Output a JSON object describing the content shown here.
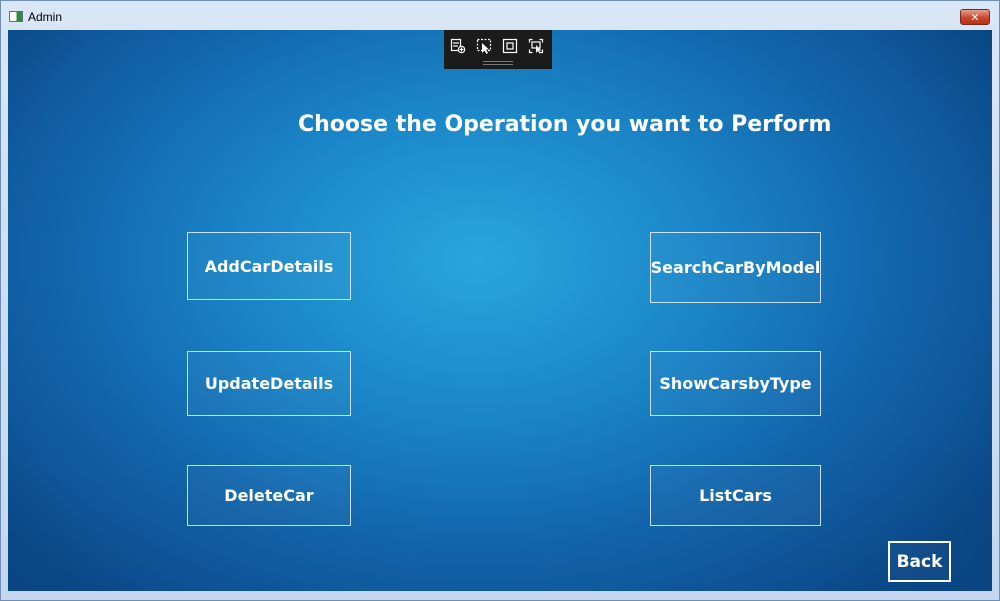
{
  "window": {
    "title": "Admin",
    "close_glyph": "✕"
  },
  "debug_toolbar": {
    "icons": [
      "select-element-icon",
      "pointer-icon",
      "layout-adorner-icon",
      "track-focus-icon"
    ]
  },
  "main": {
    "heading": "Choose the Operation you want to Perform",
    "buttons": {
      "add": "AddCarDetails",
      "search": "SearchCarByModel",
      "update": "UpdateDetails",
      "show_type": "ShowCarsbyType",
      "delete": "DeleteCar",
      "list": "ListCars",
      "back": "Back"
    }
  },
  "colors": {
    "background_accent": "#1a85c7",
    "button_border": "#dcebfa",
    "text": "#ffffff"
  }
}
